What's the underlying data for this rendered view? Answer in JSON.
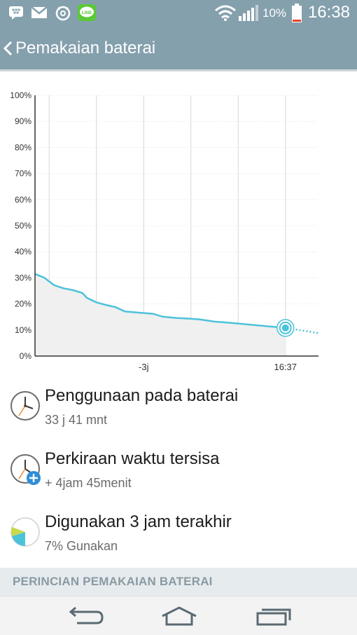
{
  "status_bar": {
    "battery_percent": "10%",
    "time": "16:38",
    "icons": [
      "bbm-icon",
      "gmail-icon",
      "alarm-settings-icon",
      "line-icon",
      "wifi-icon",
      "signal-icon",
      "battery-low-icon"
    ]
  },
  "header": {
    "title": "Pemakaian baterai",
    "back_icon": "chevron-left-icon"
  },
  "chart_data": {
    "type": "area",
    "title": "",
    "xlabel": "",
    "ylabel": "",
    "y_ticks": [
      "100%",
      "90%",
      "80%",
      "70%",
      "60%",
      "50%",
      "40%",
      "30%",
      "20%",
      "10%",
      "0%"
    ],
    "ylim": [
      0,
      100
    ],
    "x_tick_labels": [
      "-3j",
      "16:37"
    ],
    "x_hours_range": [
      -5.3,
      0.7
    ],
    "x_tick_hours": [
      -3,
      0
    ],
    "grid_x_hours": [
      -5,
      -4,
      -3,
      -2,
      -1,
      0
    ],
    "series": [
      {
        "points": [
          [
            -5.3,
            31.5
          ],
          [
            -5.1,
            30
          ],
          [
            -4.9,
            27.2
          ],
          [
            -4.7,
            26
          ],
          [
            -4.5,
            25.3
          ],
          [
            -4.3,
            24.2
          ],
          [
            -4.2,
            22.3
          ],
          [
            -4.0,
            20.6
          ],
          [
            -3.8,
            19.6
          ],
          [
            -3.6,
            18.8
          ],
          [
            -3.4,
            17.1
          ],
          [
            -3.2,
            16.8
          ],
          [
            -3.0,
            16.5
          ],
          [
            -2.8,
            16.2
          ],
          [
            -2.6,
            15.1
          ],
          [
            -2.3,
            14.6
          ],
          [
            -2.0,
            14.3
          ],
          [
            -1.8,
            14
          ],
          [
            -1.5,
            13.2
          ],
          [
            -1.2,
            12.8
          ],
          [
            -0.9,
            12.3
          ],
          [
            -0.6,
            11.8
          ],
          [
            -0.3,
            11.3
          ],
          [
            0,
            10.8
          ]
        ]
      },
      {
        "style": "dotted",
        "points": [
          [
            0,
            10.8
          ],
          [
            0.7,
            8.8
          ]
        ]
      }
    ],
    "grid": true,
    "current_marker": {
      "x": 0,
      "y": 10.8
    }
  },
  "rows": [
    {
      "title": "Penggunaan pada baterai",
      "subtitle": "33 j 41 mnt",
      "icon": "clock-icon"
    },
    {
      "title": "Perkiraan waktu tersisa",
      "subtitle": "+ 4jam 45menit",
      "icon": "clock-plus-icon"
    },
    {
      "title": "Digunakan 3 jam terakhir",
      "subtitle": "7% Gunakan",
      "icon": "pie-chart-icon"
    }
  ],
  "section": {
    "header": "PERINCIAN PEMAKAIAN BATERAI"
  },
  "nav": {
    "icons": [
      "back-icon",
      "home-icon",
      "recents-icon"
    ]
  },
  "colors": {
    "accent": "#4cc3d9",
    "header_bg": "#85a0ad",
    "section_bg": "#e6ebee"
  }
}
